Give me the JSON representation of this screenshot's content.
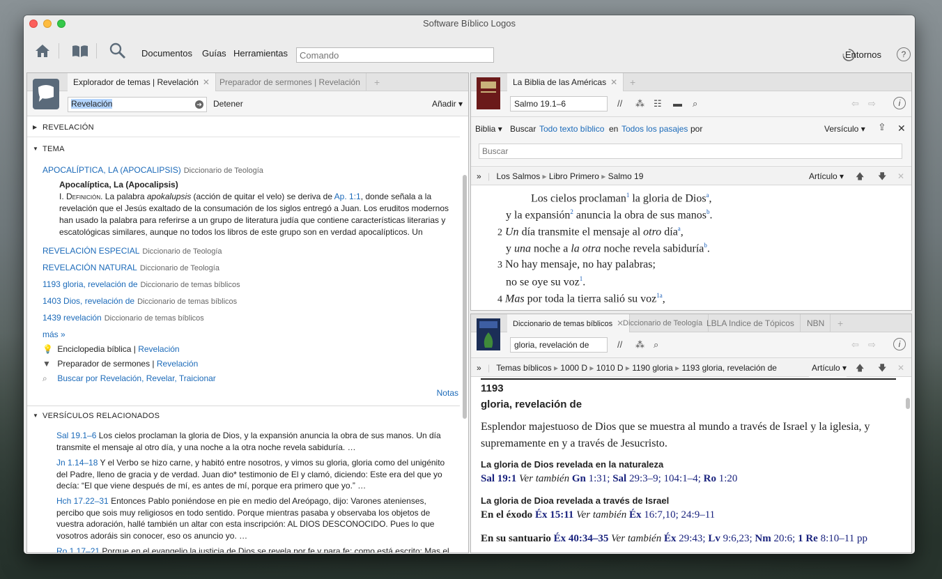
{
  "window": {
    "title": "Software Bíblico Logos"
  },
  "toolbar": {
    "menus": [
      "Documentos",
      "Guías",
      "Herramientas"
    ],
    "command_placeholder": "Comando",
    "environments": "Entornos",
    "help": "?"
  },
  "left_panel": {
    "tabs": [
      {
        "label": "Explorador de temas | Revelación",
        "active": true
      },
      {
        "label": "Preparador de sermones | Revelación",
        "active": false
      }
    ],
    "search_value": "Revelación",
    "stop_label": "Detener",
    "add_label": "Añadir",
    "sections": {
      "revelacion": "REVELACIÓN",
      "tema": "TEMA",
      "versiculos": "VERSÍCULOS RELACIONADOS"
    },
    "topic_first": {
      "title": "APOCALÍPTICA, LA (APOCALIPSIS)",
      "source": "Diccionario de Teología"
    },
    "article": {
      "heading": "Apocalíptica, La (Apocalipsis)",
      "lead": "I. Definición.",
      "t1": " La palabra ",
      "em": "apokalupsis",
      "t2": " (acción de quitar el velo) se deriva de ",
      "ref": "Ap. 1:1",
      "t3": ", donde señala a la revelación que el Jesús exaltado de la consumación de los siglos entregó a Juan. Los eruditos modernos han usado la palabra para referirse a un grupo de literatura judía que contiene características literarias y escatológicas similares, aunque no todos los libros de este grupo son en verdad apocalípticos. Un"
    },
    "topics": [
      {
        "title": "REVELACIÓN ESPECIAL",
        "source": "Diccionario de Teología"
      },
      {
        "title": "REVELACIÓN NATURAL",
        "source": "Diccionario de Teología"
      },
      {
        "title": "1193 gloria, revelación de",
        "source": "Diccionario de temas bíblicos"
      },
      {
        "title": "1403 Dios, revelación de",
        "source": "Diccionario de temas bíblicos"
      },
      {
        "title": "1439 revelación",
        "source": "Diccionario de temas bíblicos"
      }
    ],
    "more": "más »",
    "tools": [
      {
        "label": "Enciclopedia bíblica",
        "link": "Revelación"
      },
      {
        "label": "Preparador de sermones",
        "link": "Revelación"
      },
      {
        "label": "",
        "link": "Buscar por Revelación, Revelar, Traicionar"
      }
    ],
    "notes": "Notas",
    "verses": [
      {
        "ref": "Sal 19.1–6",
        "text": "Los cielos proclaman la gloria de Dios, y la expansión anuncia la obra de sus manos. Un día transmite el mensaje al otro día, y una noche a la otra noche revela sabiduría. …"
      },
      {
        "ref": "Jn 1.14–18",
        "text": "Y el Verbo se hizo carne, y habitó entre nosotros, y vimos su gloria, gloria como del unigénito del Padre, lleno de gracia y de verdad. Juan dio* testimonio de El y clamó, diciendo: Este era del que yo decía: “El que viene después de mí, es antes de mí, porque era primero que yo.” …"
      },
      {
        "ref": "Hch 17.22–31",
        "text": "Entonces Pablo poniéndose en pie en medio del Areópago, dijo: Varones atenienses, percibo que sois muy religiosos en todo sentido. Porque mientras pasaba y observaba los objetos de vuestra adoración, hallé también un altar con esta inscripción: AL DIOS DESCONOCIDO. Pues lo que vosotros adoráis sin conocer, eso os anuncio yo. …"
      },
      {
        "ref": "Ro 1.17–21",
        "text": "Porque en el evangelio la justicia de Dios se revela por fe y para fe; como está escrito: Mas el"
      }
    ]
  },
  "bible_panel": {
    "tab": "La Biblia de las Américas",
    "reference": "Salmo 19.1–6",
    "search": {
      "biblia": "Biblia",
      "buscar": "Buscar",
      "scope": "Todo texto bíblico",
      "en": "en",
      "range": "Todos los pasajes",
      "por": "por",
      "unit": "Versículo",
      "placeholder": "Buscar"
    },
    "breadcrumb": [
      "Los Salmos",
      "Libro Primero",
      "Salmo 19"
    ],
    "article_menu": "Artículo",
    "lines": [
      {
        "num": "",
        "text": "Los cielos proclaman",
        "sup1": "1",
        "rest": " la gloria de Dios",
        "sup2": "a",
        "end": ","
      },
      {
        "num": "",
        "text": "y la expansión",
        "sup1": "2",
        "rest": " anuncia la obra de sus manos",
        "sup2": "b",
        "end": "."
      },
      {
        "num": "2",
        "text": "Un día transmite el mensaje al otro día",
        "sup1": "",
        "rest": "",
        "sup2": "a",
        "end": ","
      },
      {
        "num": "",
        "text": "y una noche a la otra noche revela sabiduría",
        "sup1": "",
        "rest": "",
        "sup2": "b",
        "end": "."
      },
      {
        "num": "3",
        "text": "No hay mensaje, no hay palabras;",
        "sup1": "",
        "rest": "",
        "sup2": "",
        "end": ""
      },
      {
        "num": "",
        "text": "no se oye su voz",
        "sup1": "1",
        "rest": "",
        "sup2": "",
        "end": "."
      },
      {
        "num": "4",
        "text": "Mas por toda la tierra salió su voz",
        "sup1": "1a",
        "rest": "",
        "sup2": "",
        "end": ","
      }
    ]
  },
  "dict_panel": {
    "tabs": [
      {
        "label": "Diccionario de temas bíblicos",
        "active": true
      },
      {
        "label": "Diccionario de Teología",
        "active": false
      },
      {
        "label": "LBLA Indice de Tópicos",
        "active": false
      },
      {
        "label": "NBN",
        "active": false
      }
    ],
    "reference": "gloria, revelación de",
    "breadcrumb": [
      "Temas bíblicos",
      "1000 D",
      "1010 D",
      "1190 gloria",
      "1193 gloria, revelación de"
    ],
    "article_menu": "Artículo",
    "number": "1193",
    "title": "gloria, revelación de",
    "intro": "Esplendor majestuoso de Dios que se muestra al mundo a través de Israel y la iglesia, y supremamente en y a través de Jesucristo.",
    "h1": "La gloria de Dios revelada en la naturaleza",
    "r1": {
      "a": "Sal 19:1",
      "b": "Ver también",
      "c": "Gn",
      "d": "1:31;",
      "e": "Sal",
      "f": "29:3–9; 104:1–4;",
      "g": "Ro",
      "h": "1:20"
    },
    "h2": "La gloria de Dioa revelada a través de Israel",
    "r2": {
      "a": "En el éxodo",
      "b": "Éx 15:11",
      "c": "Ver también",
      "d": "Éx",
      "e": "16:7,10; 24:9–11"
    },
    "r3": {
      "a": "En su santuario",
      "b": "Éx 40:34–35",
      "c": "Ver también",
      "d": "Éx",
      "e": "29:43;",
      "f": "Lv",
      "g": "9:6,23;",
      "h": "Nm",
      "i": "20:6;",
      "j": "1 Re",
      "k": "8:10–11 pp"
    }
  }
}
